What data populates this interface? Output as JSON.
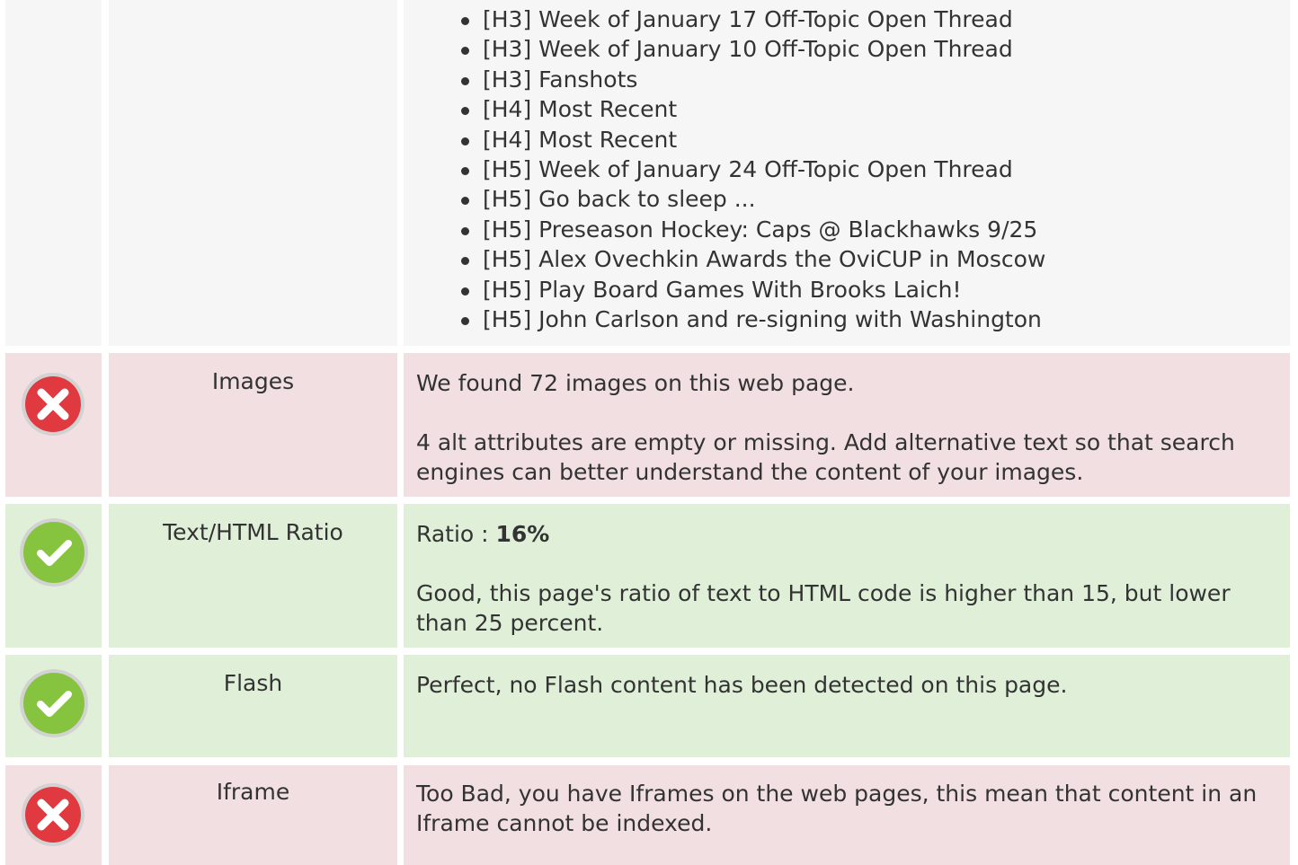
{
  "headings": [
    "[H3] Week of January 17 Off-Topic Open Thread",
    "[H3] Week of January 10 Off-Topic Open Thread",
    "[H3] Fanshots",
    "[H4] Most Recent",
    "[H4] Most Recent",
    "[H5] Week of January 24 Off-Topic Open Thread",
    "[H5] Go back to sleep ...",
    "[H5] Preseason Hockey: Caps @ Blackhawks 9/25",
    "[H5] Alex Ovechkin Awards the OviCUP in Moscow",
    "[H5] Play Board Games With Brooks Laich!",
    "[H5] John Carlson and re-signing with Washington"
  ],
  "images": {
    "name": "Images",
    "status": "fail",
    "icon": "error-icon",
    "line1": "We found 72 images on this web page.",
    "line2": "4 alt attributes are empty or missing. Add alternative text so that search engines can better understand the content of your images."
  },
  "ratio": {
    "name": "Text/HTML Ratio",
    "status": "pass",
    "icon": "check-icon",
    "label": "Ratio : ",
    "value": "16%",
    "line2": "Good, this page's ratio of text to HTML code is higher than 15, but lower than 25 percent."
  },
  "flash": {
    "name": "Flash",
    "status": "pass",
    "icon": "check-icon",
    "line1": "Perfect, no Flash content has been detected on this page."
  },
  "iframe": {
    "name": "Iframe",
    "status": "fail",
    "icon": "error-icon",
    "line1": "Too Bad, you have Iframes on the web pages, this mean that content in an Iframe cannot be indexed."
  },
  "colors": {
    "fail_bg": "#f1dfe1",
    "pass_bg": "#e0f0d8",
    "neutral_bg": "#f6f6f6",
    "error_red": "#e0393f",
    "success_green": "#86c440"
  }
}
